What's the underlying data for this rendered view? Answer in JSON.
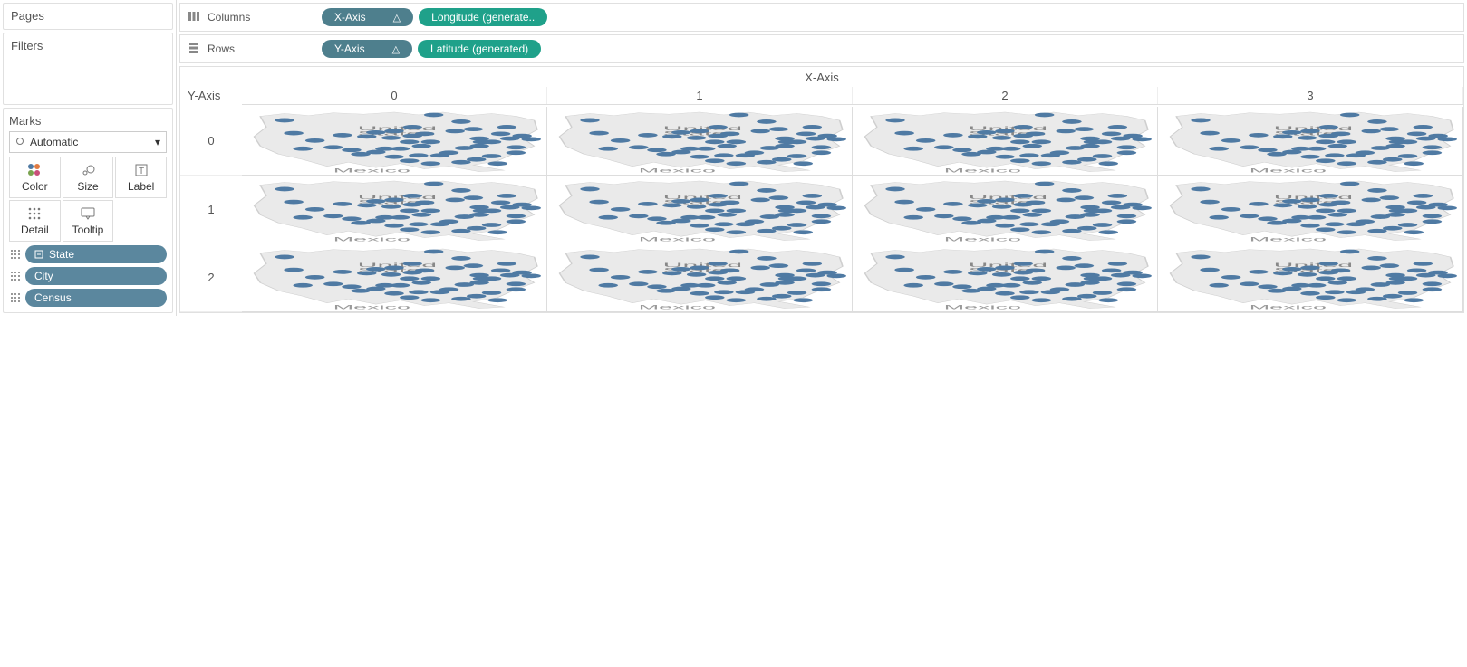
{
  "panels": {
    "pages": "Pages",
    "filters": "Filters",
    "marks": "Marks"
  },
  "marks": {
    "type_label": "Automatic",
    "buttons": {
      "color": "Color",
      "size": "Size",
      "label": "Label",
      "detail": "Detail",
      "tooltip": "Tooltip"
    },
    "detail_pills": [
      "State",
      "City",
      "Census"
    ]
  },
  "shelves": {
    "columns": {
      "label": "Columns",
      "pills": [
        {
          "text": "X-Axis",
          "style": "teal",
          "delta": "△"
        },
        {
          "text": "Longitude (generate..",
          "style": "green"
        }
      ]
    },
    "rows": {
      "label": "Rows",
      "pills": [
        {
          "text": "Y-Axis",
          "style": "teal",
          "delta": "△"
        },
        {
          "text": "Latitude (generated)",
          "style": "green"
        }
      ]
    }
  },
  "viz": {
    "x_title": "X-Axis",
    "y_title": "Y-Axis",
    "col_headers": [
      "0",
      "1",
      "2",
      "3"
    ],
    "row_headers": [
      "0",
      "1",
      "2"
    ],
    "country_label": "United States",
    "mexico_label": "Mexico",
    "dots": [
      [
        14,
        20
      ],
      [
        17,
        39
      ],
      [
        63,
        12
      ],
      [
        72,
        22
      ],
      [
        76,
        33
      ],
      [
        70,
        36
      ],
      [
        87,
        30
      ],
      [
        85,
        40
      ],
      [
        78,
        47
      ],
      [
        79,
        52
      ],
      [
        60,
        40
      ],
      [
        56,
        43
      ],
      [
        44,
        38
      ],
      [
        41,
        44
      ],
      [
        33,
        42
      ],
      [
        24,
        50
      ],
      [
        20,
        62
      ],
      [
        30,
        60
      ],
      [
        36,
        64
      ],
      [
        39,
        70
      ],
      [
        44,
        67
      ],
      [
        47,
        62
      ],
      [
        50,
        74
      ],
      [
        52,
        62
      ],
      [
        55,
        80
      ],
      [
        58,
        72
      ],
      [
        62,
        84
      ],
      [
        65,
        72
      ],
      [
        68,
        68
      ],
      [
        73,
        61
      ],
      [
        78,
        58
      ],
      [
        82,
        52
      ],
      [
        88,
        47
      ],
      [
        92,
        43
      ],
      [
        95,
        48
      ],
      [
        90,
        60
      ],
      [
        82,
        73
      ],
      [
        77,
        78
      ],
      [
        72,
        82
      ],
      [
        84,
        84
      ],
      [
        90,
        68
      ],
      [
        62,
        52
      ],
      [
        59,
        58
      ],
      [
        55,
        52
      ],
      [
        49,
        46
      ],
      [
        50,
        36
      ],
      [
        56,
        30
      ]
    ]
  }
}
